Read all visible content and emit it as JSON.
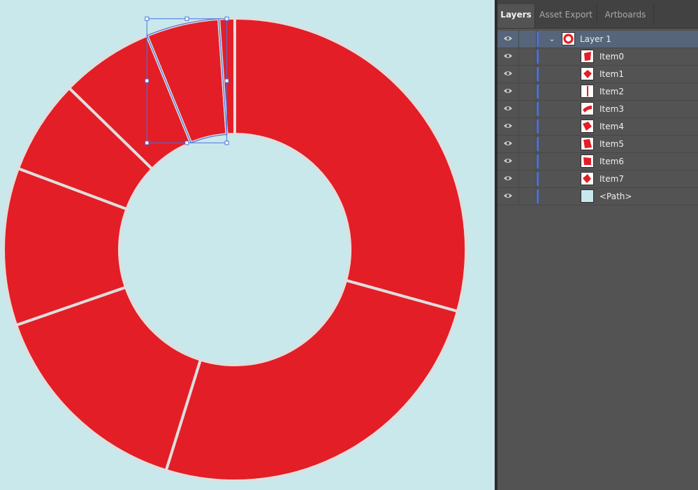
{
  "colors": {
    "canvas_bg": "#c8e8ec",
    "segment_fill": "#e31e26",
    "segment_stroke": "#dedede",
    "selection": "#4d72e0",
    "panel_bg": "#535353",
    "layer_color": "#4b6fd6"
  },
  "panel": {
    "tabs": [
      {
        "label": "Layers",
        "active": true
      },
      {
        "label": "Asset Export",
        "active": false
      },
      {
        "label": "Artboards",
        "active": false
      }
    ],
    "layer": {
      "name": "Layer 1",
      "expanded": true,
      "icon": "target-icon"
    },
    "items": [
      {
        "name": "Item0",
        "icon": "eye-icon"
      },
      {
        "name": "Item1",
        "icon": "eye-icon"
      },
      {
        "name": "Item2",
        "icon": "eye-icon"
      },
      {
        "name": "Item3",
        "icon": "eye-icon"
      },
      {
        "name": "Item4",
        "icon": "eye-icon"
      },
      {
        "name": "Item5",
        "icon": "eye-icon"
      },
      {
        "name": "Item6",
        "icon": "eye-icon"
      },
      {
        "name": "Item7",
        "icon": "eye-icon"
      },
      {
        "name": "<Path>",
        "icon": "eye-icon"
      }
    ]
  },
  "chart_data": {
    "type": "pie",
    "style": "donut",
    "segments_percent": [
      29.3,
      25.5,
      14.9,
      11.0,
      6.6,
      6.5,
      5.1,
      1.1
    ],
    "selected_segment": 6
  }
}
